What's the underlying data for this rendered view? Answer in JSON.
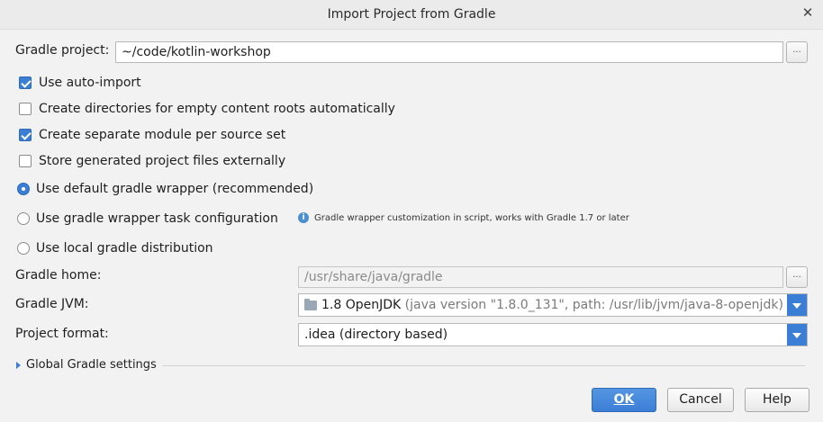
{
  "window": {
    "title": "Import Project from Gradle",
    "close_icon": "close-icon"
  },
  "gradle_project": {
    "label": "Gradle project:",
    "value": "~/code/kotlin-workshop",
    "browse_label": "..."
  },
  "options": {
    "auto_import": {
      "label": "Use auto-import",
      "checked": true
    },
    "create_dirs": {
      "label": "Create directories for empty content roots automatically",
      "checked": false
    },
    "separate_module": {
      "label": "Create separate module per source set",
      "checked": true
    },
    "store_external": {
      "label": "Store generated project files externally",
      "checked": false
    }
  },
  "distribution": {
    "default_wrapper": {
      "label": "Use default gradle wrapper (recommended)",
      "selected": true
    },
    "wrapper_task": {
      "label": "Use gradle wrapper task configuration",
      "selected": false
    },
    "wrapper_task_hint": "Gradle wrapper customization in script, works with Gradle 1.7 or later",
    "local": {
      "label": "Use local gradle distribution",
      "selected": false
    }
  },
  "gradle_home": {
    "label": "Gradle home:",
    "value": "/usr/share/java/gradle",
    "browse_label": "..."
  },
  "gradle_jvm": {
    "label": "Gradle JVM:",
    "value_main": "1.8 OpenJDK",
    "value_detail": "(java version \"1.8.0_131\", path: /usr/lib/jvm/java-8-openjdk)"
  },
  "project_format": {
    "label": "Project format:",
    "value": ".idea (directory based)"
  },
  "global_settings": {
    "label": "Global Gradle settings"
  },
  "buttons": {
    "ok": "OK",
    "cancel": "Cancel",
    "help": "Help"
  },
  "colors": {
    "accent": "#3a7ed6",
    "background": "#f2f2f2"
  }
}
